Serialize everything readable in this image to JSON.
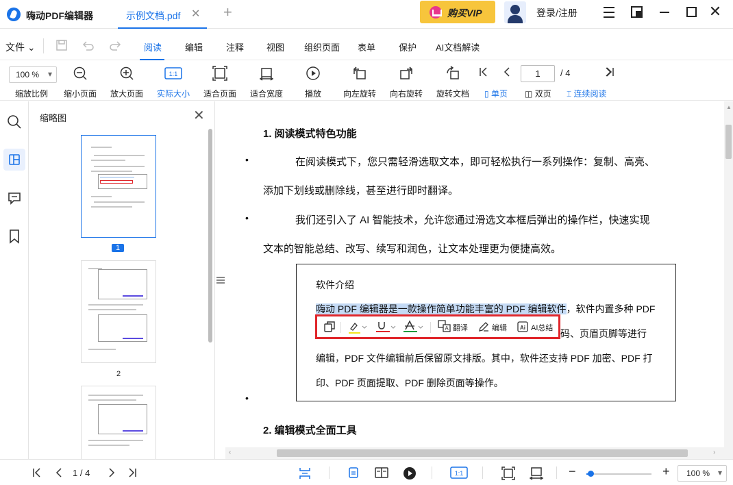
{
  "titlebar": {
    "app_name": "嗨动PDF编辑器",
    "doc_tab": "示例文档.pdf",
    "close_glyph": "✕",
    "new_tab_glyph": "+",
    "vip_label": "购买VIP",
    "login_label": "登录/注册",
    "close_window_glyph": "✕"
  },
  "menubar": {
    "file_label": "文件",
    "items": [
      "阅读",
      "编辑",
      "注释",
      "视图",
      "组织页面",
      "表单",
      "保护",
      "AI文档解读"
    ],
    "active": "阅读"
  },
  "toolbar": {
    "zoom_value": "100 %",
    "zoom_label": "缩放比例",
    "tools": [
      "缩小页面",
      "放大页面",
      "实际大小",
      "适合页面",
      "适合宽度",
      "播放",
      "向左旋转",
      "向右旋转",
      "旋转文档"
    ],
    "active_tool": "实际大小",
    "actual_size_badge": "1:1",
    "current_page": "1",
    "total_pages": "/ 4",
    "view_options": [
      "单页",
      "双页",
      "连续阅读"
    ],
    "active_views": [
      "单页",
      "连续阅读"
    ]
  },
  "thumbnails": {
    "title": "缩略图",
    "close_glyph": "✕",
    "pages": [
      "1",
      "2"
    ],
    "active_page": "1"
  },
  "document": {
    "heading1": "1. 阅读模式特色功能",
    "bullet1_line1": "在阅读模式下，您只需轻滑选取文本，即可轻松执行一系列操作：复制、高亮、",
    "bullet1_line2": "添加下划线或删除线，甚至进行即时翻译。",
    "bullet2_line1": "我们还引入了 AI 智能技术，允许您通过滑选文本框后弹出的操作栏，快速实现",
    "bullet2_line2": "文本的智能总结、改写、续写和润色，让文本处理更为便捷高效。",
    "box_title": "软件介绍",
    "box_line1_highlight": "嗨动 PDF 编辑器是一款操作简单功能丰富的 PDF 编辑软件",
    "box_line1_rest": "，软件内置多种 PDF",
    "box_line2_tail": "码、页眉页脚等进行",
    "box_line3": "编辑，PDF 文件编辑前后保留原文排版。其中，软件还支持 PDF 加密、PDF 打",
    "box_line4": "印、PDF 页面提取、PDF 删除页面等操作。",
    "popup": {
      "translate": "翻译",
      "edit": "编辑",
      "ai_summary": "AI总结"
    },
    "heading2": "2. 编辑模式全面工具"
  },
  "statusbar": {
    "page_display": "1 / 4",
    "zoom_value": "100 %",
    "zoom_level": 0.06,
    "actual_size_badge": "1:1",
    "zoom_out_glyph": "−",
    "zoom_in_glyph": "+"
  },
  "colors": {
    "accent": "#1a73e8",
    "vip_bg": "#f7c53c",
    "popup_border": "#e0262b",
    "highlight": "#c4daf5"
  }
}
